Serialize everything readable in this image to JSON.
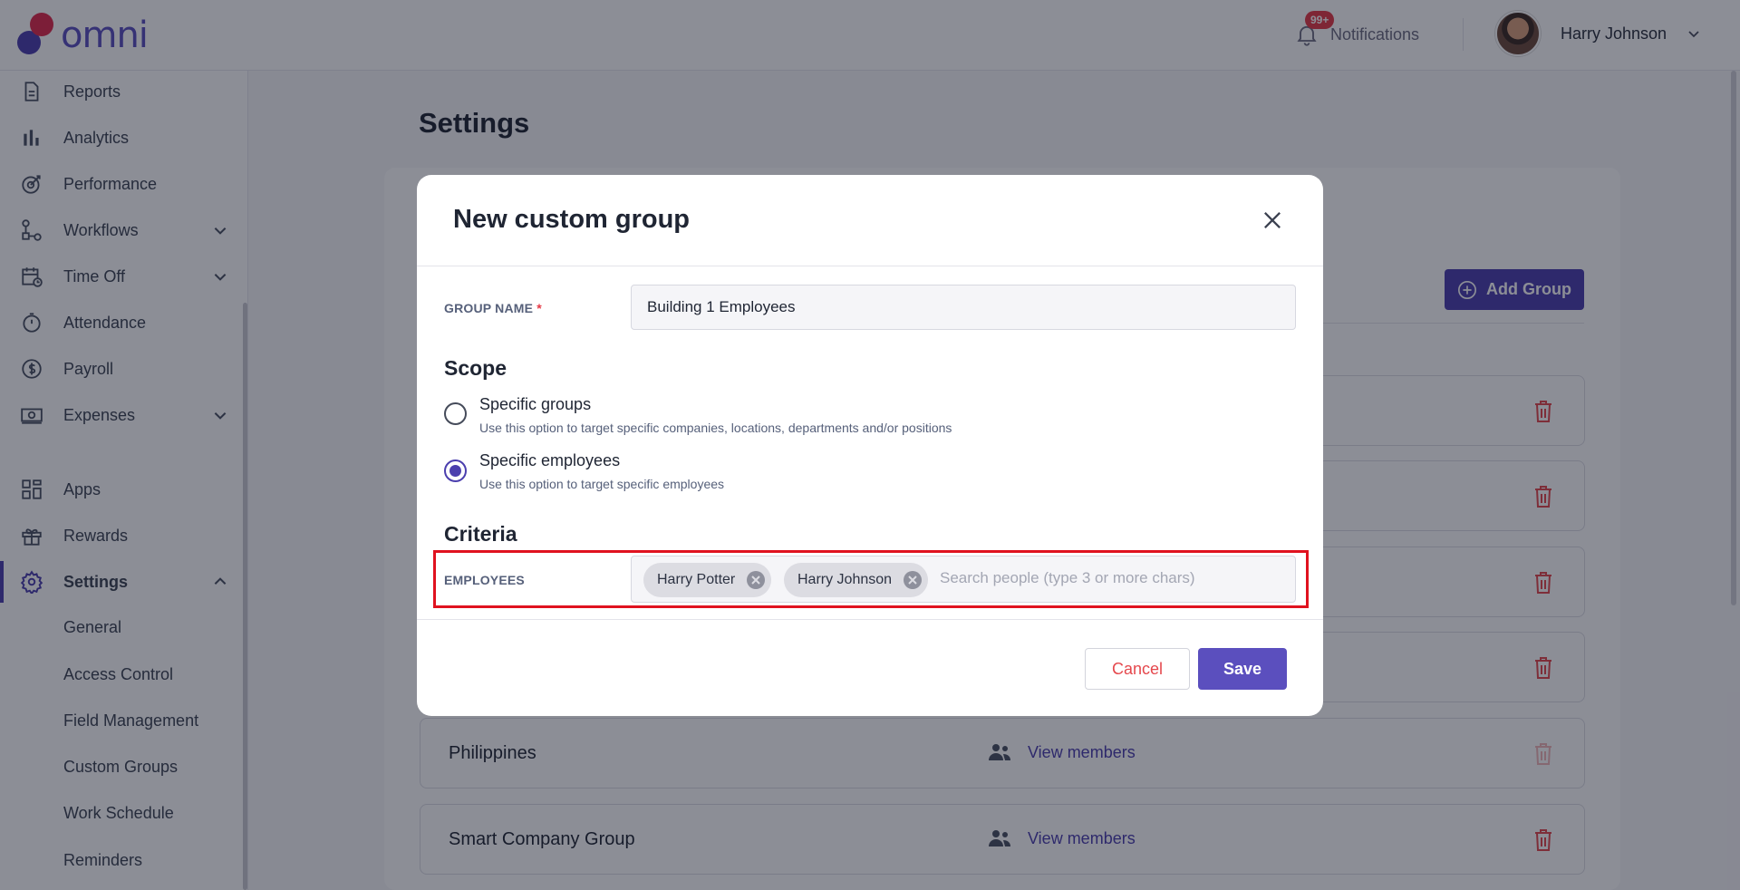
{
  "app": {
    "logo_text": "omni"
  },
  "header": {
    "notifications_badge": "99+",
    "notifications_label": "Notifications",
    "user_name": "Harry Johnson"
  },
  "sidebar": {
    "items": [
      {
        "label": "Reports",
        "icon": "document-icon"
      },
      {
        "label": "Analytics",
        "icon": "bar-chart-icon"
      },
      {
        "label": "Performance",
        "icon": "target-icon"
      },
      {
        "label": "Workflows",
        "icon": "workflow-icon"
      },
      {
        "label": "Time Off",
        "icon": "calendar-icon"
      },
      {
        "label": "Attendance",
        "icon": "stopwatch-icon"
      },
      {
        "label": "Payroll",
        "icon": "dollar-icon"
      },
      {
        "label": "Expenses",
        "icon": "cash-icon"
      },
      {
        "label": "Apps",
        "icon": "grid-icon"
      },
      {
        "label": "Rewards",
        "icon": "gift-icon"
      },
      {
        "label": "Settings",
        "icon": "gear-icon"
      }
    ],
    "settings_sub": [
      "General",
      "Access Control",
      "Field Management",
      "Custom Groups",
      "Work Schedule",
      "Reminders"
    ]
  },
  "main": {
    "title": "Settings",
    "add_group_label": "Add Group",
    "view_members_label": "View members",
    "groups": [
      "Philippines",
      "Smart Company Group"
    ]
  },
  "modal": {
    "title": "New custom group",
    "group_name_label": "GROUP NAME",
    "required_mark": "*",
    "group_name_value": "Building 1 Employees",
    "scope_heading": "Scope",
    "options": [
      {
        "title": "Specific groups",
        "desc": "Use this option to target specific companies, locations, departments and/or positions",
        "checked": false
      },
      {
        "title": "Specific employees",
        "desc": "Use this option to target specific employees",
        "checked": true
      }
    ],
    "criteria_heading": "Criteria",
    "employees_label": "EMPLOYEES",
    "selected_employees": [
      "Harry Potter",
      "Harry Johnson"
    ],
    "search_placeholder": "Search people (type 3 or more chars)",
    "cancel_label": "Cancel",
    "save_label": "Save"
  },
  "colors": {
    "brand": "#4b3fae",
    "danger": "#e5484d",
    "highlight": "#e0121f"
  }
}
